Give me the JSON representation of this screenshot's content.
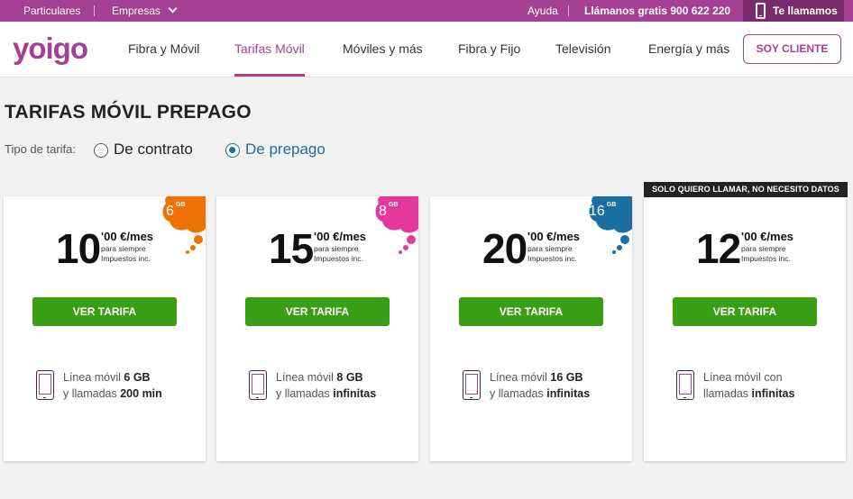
{
  "colors": {
    "brand": "#a53f93",
    "brand_dark": "#7b2b6c",
    "button_green": "#3a9e14",
    "link_blue": "#1a6fa0",
    "badge_orange": "#ee7203",
    "badge_pink": "#e5389b",
    "badge_blue": "#1a6fa0"
  },
  "topbar": {
    "particulares": "Particulares",
    "empresas": "Empresas",
    "ayuda": "Ayuda",
    "llamanos": "Llámanos gratis 900 622 220",
    "te_llamamos": "Te llamamos"
  },
  "nav": {
    "logo": "yoigo",
    "links": [
      "Fibra y Móvil",
      "Tarifas Móvil",
      "Móviles y más",
      "Fibra y Fijo",
      "Televisión",
      "Energía y más"
    ],
    "active": "Tarifas Móvil",
    "soy_cliente": "SOY CLIENTE"
  },
  "page": {
    "title": "TARIFAS MÓVIL PREPAGO",
    "tipo_label": "Tipo de tarifa:",
    "options": [
      {
        "label": "De contrato",
        "selected": false
      },
      {
        "label": "De prepago",
        "selected": true
      }
    ]
  },
  "cards": [
    {
      "banner": "",
      "badge_value": "6",
      "badge_unit": "GB",
      "badge_color": "orange",
      "price_int": "10",
      "price_dec": "'00 €/mes",
      "note1": "para siempre",
      "note2": "Impuestos inc.",
      "button": "VER TARIFA",
      "feature_line1_prefix": "Línea móvil ",
      "feature_line1_bold": "6 GB",
      "feature_line2_prefix": "y llamadas ",
      "feature_line2_bold": "200 min"
    },
    {
      "banner": "",
      "badge_value": "8",
      "badge_unit": "GB",
      "badge_color": "pink",
      "price_int": "15",
      "price_dec": "'00 €/mes",
      "note1": "para siempre",
      "note2": "Impuestos inc.",
      "button": "VER TARIFA",
      "feature_line1_prefix": "Línea móvil ",
      "feature_line1_bold": "8 GB",
      "feature_line2_prefix": "y llamadas ",
      "feature_line2_bold": "infinitas"
    },
    {
      "banner": "",
      "badge_value": "16",
      "badge_unit": "GB",
      "badge_color": "blue",
      "price_int": "20",
      "price_dec": "'00 €/mes",
      "note1": "para siempre",
      "note2": "Impuestos inc.",
      "button": "VER TARIFA",
      "feature_line1_prefix": "Línea móvil ",
      "feature_line1_bold": "16 GB",
      "feature_line2_prefix": "y llamadas ",
      "feature_line2_bold": "infinitas"
    },
    {
      "banner": "SOLO QUIERO LLAMAR, NO NECESITO DATOS",
      "badge_value": "",
      "badge_unit": "",
      "badge_color": "",
      "price_int": "12",
      "price_dec": "'00 €/mes",
      "note1": "para siempre",
      "note2": "Impuestos inc.",
      "button": "VER TARIFA",
      "feature_line1_prefix": "Línea móvil con",
      "feature_line1_bold": "",
      "feature_line2_prefix": "llamadas ",
      "feature_line2_bold": "infinitas"
    }
  ]
}
